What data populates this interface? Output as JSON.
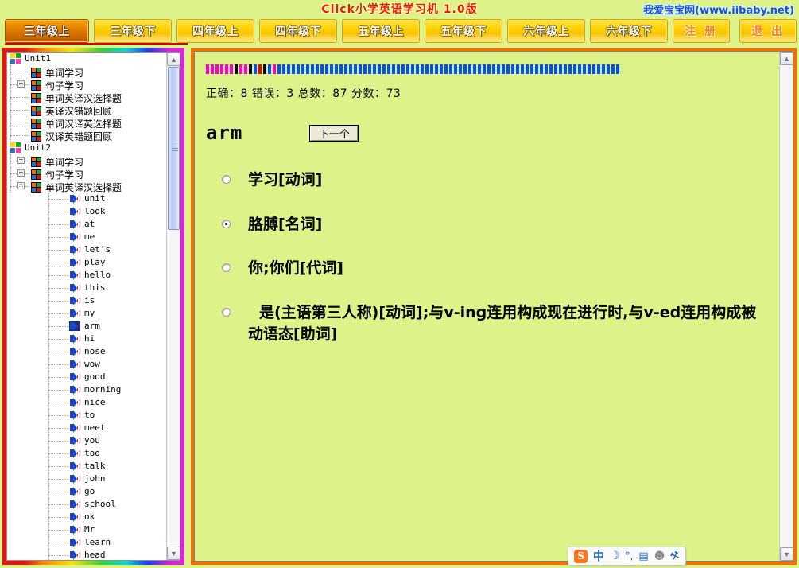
{
  "header": {
    "app_title": "Click小学英语学习机 1.0版",
    "site_link": "我爱宝宝网(www.iibaby.net)"
  },
  "tabs": [
    {
      "label": "三年级上",
      "active": true,
      "kind": "grade"
    },
    {
      "label": "三年级下",
      "active": false,
      "kind": "grade"
    },
    {
      "label": "四年级上",
      "active": false,
      "kind": "grade"
    },
    {
      "label": "四年级下",
      "active": false,
      "kind": "grade"
    },
    {
      "label": "五年级上",
      "active": false,
      "kind": "grade"
    },
    {
      "label": "五年级下",
      "active": false,
      "kind": "grade"
    },
    {
      "label": "六年级上",
      "active": false,
      "kind": "grade"
    },
    {
      "label": "六年级下",
      "active": false,
      "kind": "grade"
    },
    {
      "label": "注 册",
      "active": false,
      "kind": "action"
    },
    {
      "label": "退 出",
      "active": false,
      "kind": "action"
    }
  ],
  "tree": {
    "nodes": [
      {
        "label": "Unit1",
        "type": "unit",
        "depth": 0,
        "toggle": "none",
        "selected": false
      },
      {
        "label": "单词学习",
        "type": "group",
        "depth": 1,
        "toggle": "none",
        "selected": false
      },
      {
        "label": "句子学习",
        "type": "group",
        "depth": 1,
        "toggle": "plus",
        "selected": false
      },
      {
        "label": "单词英译汉选择题",
        "type": "group",
        "depth": 1,
        "toggle": "none",
        "selected": false
      },
      {
        "label": "英译汉错题回顾",
        "type": "group",
        "depth": 1,
        "toggle": "none",
        "selected": false
      },
      {
        "label": "单词汉译英选择题",
        "type": "group",
        "depth": 1,
        "toggle": "none",
        "selected": false
      },
      {
        "label": "汉译英错题回顾",
        "type": "group",
        "depth": 1,
        "toggle": "none",
        "selected": false
      },
      {
        "label": "Unit2",
        "type": "unit",
        "depth": 0,
        "toggle": "none",
        "selected": false
      },
      {
        "label": "单词学习",
        "type": "group",
        "depth": 1,
        "toggle": "plus",
        "selected": false
      },
      {
        "label": "句子学习",
        "type": "group",
        "depth": 1,
        "toggle": "plus",
        "selected": false
      },
      {
        "label": "单词英译汉选择题",
        "type": "group",
        "depth": 1,
        "toggle": "minus",
        "selected": false
      },
      {
        "label": "unit",
        "type": "word",
        "depth": 2,
        "toggle": "none",
        "selected": false
      },
      {
        "label": "look",
        "type": "word",
        "depth": 2,
        "toggle": "none",
        "selected": false
      },
      {
        "label": "at",
        "type": "word",
        "depth": 2,
        "toggle": "none",
        "selected": false
      },
      {
        "label": "me",
        "type": "word",
        "depth": 2,
        "toggle": "none",
        "selected": false
      },
      {
        "label": "let's",
        "type": "word",
        "depth": 2,
        "toggle": "none",
        "selected": false
      },
      {
        "label": "play",
        "type": "word",
        "depth": 2,
        "toggle": "none",
        "selected": false
      },
      {
        "label": "hello",
        "type": "word",
        "depth": 2,
        "toggle": "none",
        "selected": false
      },
      {
        "label": "this",
        "type": "word",
        "depth": 2,
        "toggle": "none",
        "selected": false
      },
      {
        "label": "is",
        "type": "word",
        "depth": 2,
        "toggle": "none",
        "selected": false
      },
      {
        "label": "my",
        "type": "word",
        "depth": 2,
        "toggle": "none",
        "selected": false
      },
      {
        "label": "arm",
        "type": "word",
        "depth": 2,
        "toggle": "none",
        "selected": true
      },
      {
        "label": "hi",
        "type": "word",
        "depth": 2,
        "toggle": "none",
        "selected": false
      },
      {
        "label": "nose",
        "type": "word",
        "depth": 2,
        "toggle": "none",
        "selected": false
      },
      {
        "label": "wow",
        "type": "word",
        "depth": 2,
        "toggle": "none",
        "selected": false
      },
      {
        "label": "good",
        "type": "word",
        "depth": 2,
        "toggle": "none",
        "selected": false
      },
      {
        "label": "morning",
        "type": "word",
        "depth": 2,
        "toggle": "none",
        "selected": false
      },
      {
        "label": "nice",
        "type": "word",
        "depth": 2,
        "toggle": "none",
        "selected": false
      },
      {
        "label": "to",
        "type": "word",
        "depth": 2,
        "toggle": "none",
        "selected": false
      },
      {
        "label": "meet",
        "type": "word",
        "depth": 2,
        "toggle": "none",
        "selected": false
      },
      {
        "label": "you",
        "type": "word",
        "depth": 2,
        "toggle": "none",
        "selected": false
      },
      {
        "label": "too",
        "type": "word",
        "depth": 2,
        "toggle": "none",
        "selected": false
      },
      {
        "label": "talk",
        "type": "word",
        "depth": 2,
        "toggle": "none",
        "selected": false
      },
      {
        "label": "john",
        "type": "word",
        "depth": 2,
        "toggle": "none",
        "selected": false
      },
      {
        "label": "go",
        "type": "word",
        "depth": 2,
        "toggle": "none",
        "selected": false
      },
      {
        "label": "school",
        "type": "word",
        "depth": 2,
        "toggle": "none",
        "selected": false
      },
      {
        "label": "ok",
        "type": "word",
        "depth": 2,
        "toggle": "none",
        "selected": false
      },
      {
        "label": "Mr",
        "type": "word",
        "depth": 2,
        "toggle": "none",
        "selected": false
      },
      {
        "label": "learn",
        "type": "word",
        "depth": 2,
        "toggle": "none",
        "selected": false
      },
      {
        "label": "head",
        "type": "word",
        "depth": 2,
        "toggle": "none",
        "selected": false
      }
    ],
    "scroll": {
      "up_icon": "chevron-up-icon",
      "down_icon": "chevron-down-icon"
    }
  },
  "quiz": {
    "progress": {
      "segments": [
        "#ff00c8",
        "#ff00c8",
        "#ff00c8",
        "#ff00c8",
        "#ff00c8",
        "#ff00c8",
        "#000000",
        "#ff00c8",
        "#ff00c8",
        "#000000",
        "#0050ff",
        "#ee0000",
        "#000000",
        "#0050ff",
        "#ff00c8",
        "#0050ff",
        "#0050ff",
        "#0050ff",
        "#0050ff",
        "#0050ff",
        "#0050ff",
        "#0050ff",
        "#0050ff",
        "#0050ff",
        "#0050ff",
        "#0050ff",
        "#0050ff",
        "#0050ff",
        "#0050ff",
        "#0050ff",
        "#0050ff",
        "#0050ff",
        "#0050ff",
        "#0050ff",
        "#0050ff",
        "#0050ff",
        "#0050ff",
        "#0050ff",
        "#0050ff",
        "#0050ff",
        "#0050ff",
        "#0050ff",
        "#0050ff",
        "#0050ff",
        "#0050ff",
        "#0050ff",
        "#0050ff",
        "#0050ff",
        "#0050ff",
        "#0050ff",
        "#0050ff",
        "#0050ff",
        "#0050ff",
        "#0050ff",
        "#0050ff",
        "#0050ff",
        "#0050ff",
        "#0050ff",
        "#0050ff",
        "#0050ff",
        "#0050ff",
        "#0050ff",
        "#0050ff",
        "#0050ff",
        "#0050ff",
        "#0050ff",
        "#0050ff",
        "#0050ff",
        "#0050ff",
        "#0050ff",
        "#0050ff",
        "#0050ff",
        "#0050ff",
        "#0050ff",
        "#0050ff",
        "#0050ff",
        "#0050ff",
        "#0050ff",
        "#0050ff",
        "#0050ff",
        "#0050ff",
        "#0050ff",
        "#0050ff",
        "#0050ff",
        "#0050ff",
        "#0050ff",
        "#0050ff"
      ]
    },
    "stats_text": "正确：8 错误：3 总数：87 分数：73",
    "stats": {
      "correct": 8,
      "wrong": 3,
      "total": 87,
      "score": 73
    },
    "word": "arm",
    "next_button": "下一个",
    "options": [
      {
        "label": "学习[动词]",
        "checked": false,
        "multiline": false
      },
      {
        "label": "胳膊[名词]",
        "checked": true,
        "multiline": false
      },
      {
        "label": "你;你们[代词]",
        "checked": false,
        "multiline": false
      },
      {
        "label": "是(主语第三人称)[动词];与v-ing连用构成现在进行时,与v-ed连用构成被动语态[助词]",
        "checked": false,
        "multiline": true
      }
    ],
    "scroll": {
      "up_icon": "chevron-up-icon",
      "down_icon": "chevron-down-icon"
    }
  },
  "ime": {
    "logo": "S",
    "lang_mode": "中",
    "moon": "☽",
    "punct": "°,",
    "keyboard": "▤",
    "user": "☻",
    "wrench": "⚒"
  }
}
